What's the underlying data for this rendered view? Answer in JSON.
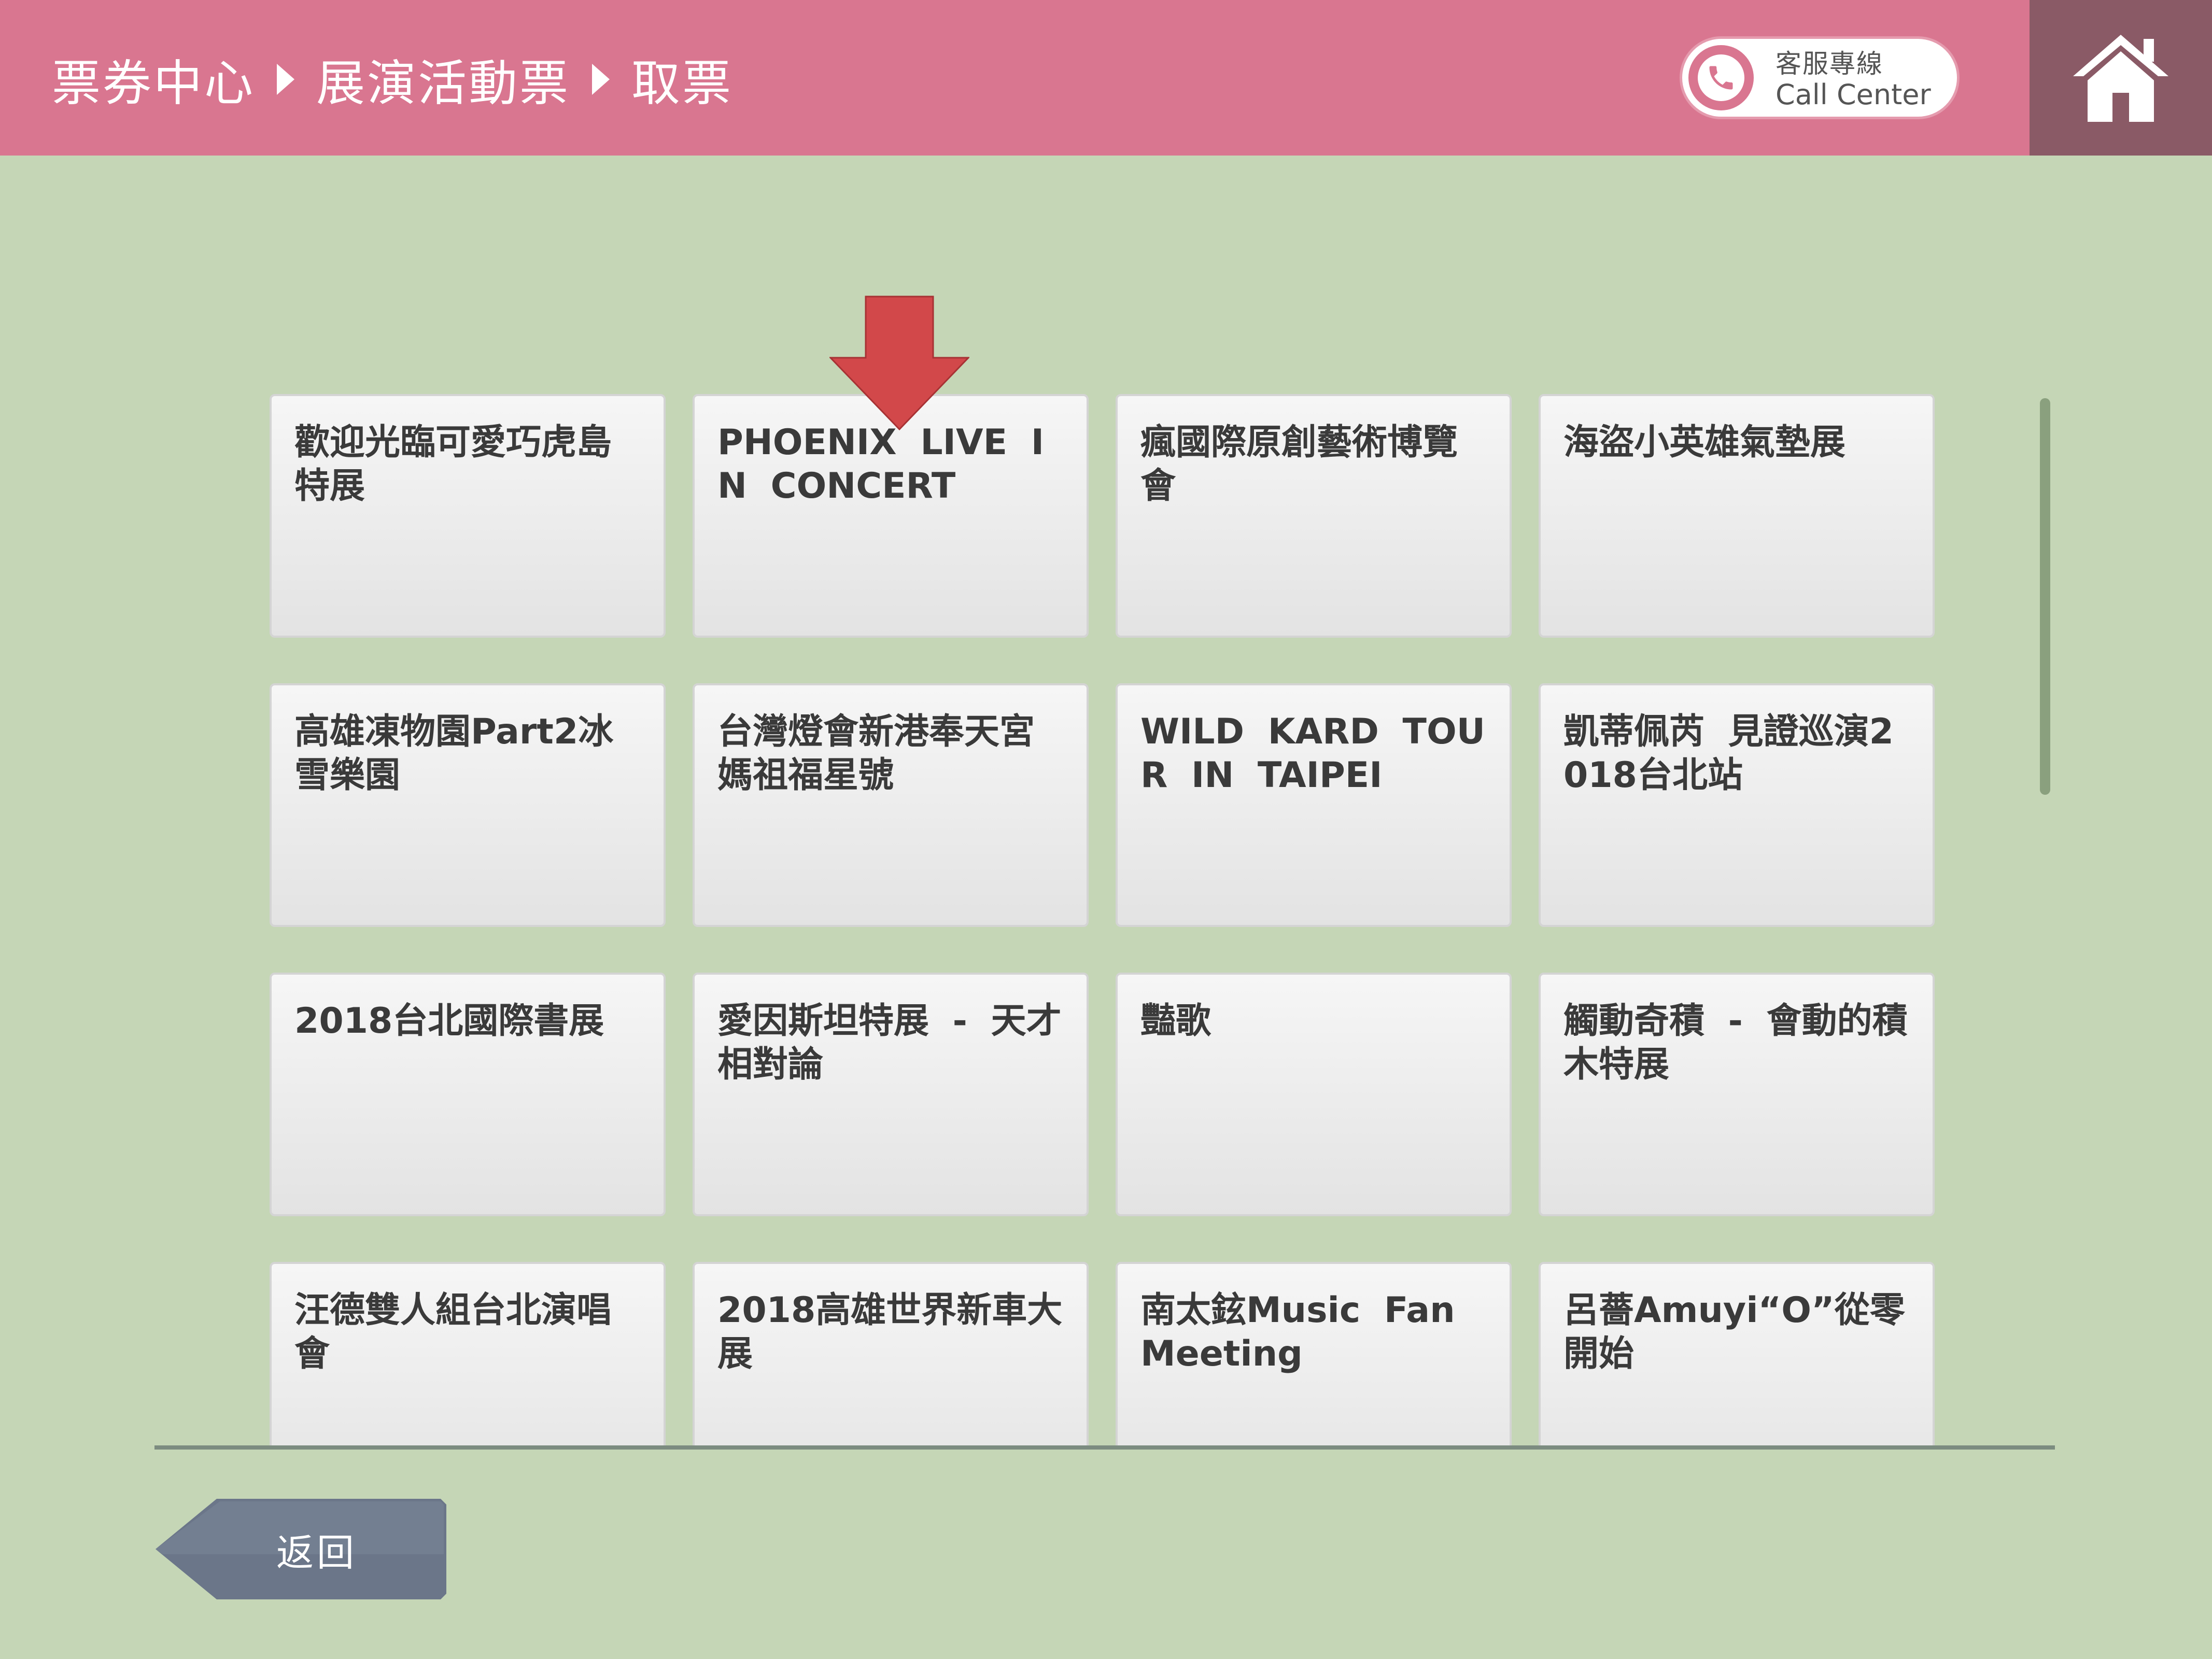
{
  "header": {
    "breadcrumb": [
      "票券中心",
      "展演活動票",
      "取票"
    ],
    "call_center": {
      "zh": "客服專線",
      "en": "Call Center"
    }
  },
  "events": [
    "歡迎光臨可愛巧虎島特展",
    "PHOENIX LIVE IN CONCERT",
    "瘋國際原創藝術博覽會",
    "海盜小英雄氣墊展",
    "高雄凍物園Part2冰雪樂園",
    "台灣燈會新港奉天宮媽祖福星號",
    "WILD KARD TOUR IN TAIPEI",
    "凱蒂佩芮 見證巡演2018台北站",
    "2018台北國際書展",
    "愛因斯坦特展 - 天才相對論",
    "豔歌",
    "觸動奇積 - 會動的積木特展",
    "汪德雙人組台北演唱會",
    "2018高雄世界新車大展",
    "南太鉉Music Fan Meeting",
    "呂薔Amuyi“O”從零開始"
  ],
  "footer": {
    "back_label": "返回"
  },
  "colors": {
    "header": "#d97690",
    "home_button": "#8a5a66",
    "background": "#c5d6b6",
    "arrow": "#d2484a"
  }
}
